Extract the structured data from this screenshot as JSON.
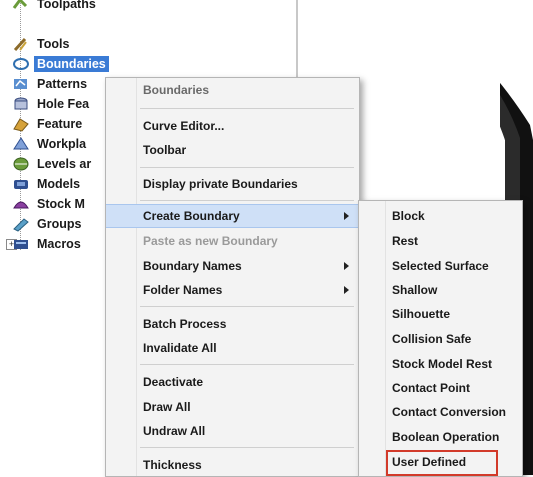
{
  "tree": {
    "items": [
      {
        "label": "Toolpaths",
        "icon": "toolpaths-icon"
      },
      {
        "label": "Tools",
        "icon": "tools-icon"
      },
      {
        "label": "Boundaries",
        "icon": "boundaries-icon",
        "selected": true
      },
      {
        "label": "Patterns",
        "icon": "patterns-icon"
      },
      {
        "label": "Hole Fea",
        "icon": "hole-features-icon"
      },
      {
        "label": "Feature",
        "icon": "feature-icon"
      },
      {
        "label": "Workpla",
        "icon": "workplanes-icon"
      },
      {
        "label": "Levels ar",
        "icon": "levels-icon"
      },
      {
        "label": "Models",
        "icon": "models-icon"
      },
      {
        "label": "Stock M",
        "icon": "stock-models-icon"
      },
      {
        "label": "Groups",
        "icon": "groups-icon"
      },
      {
        "label": "Macros",
        "icon": "macros-icon"
      }
    ],
    "selection_color": "#3a7bd5"
  },
  "menu": {
    "header": "Boundaries",
    "items": [
      {
        "label": "Curve Editor..."
      },
      {
        "label": "Toolbar"
      },
      {
        "label": "Display private Boundaries"
      },
      {
        "label": "Create Boundary",
        "submenu": true,
        "active": true
      },
      {
        "label": "Paste as new Boundary",
        "disabled": true
      },
      {
        "label": "Boundary Names",
        "submenu": true
      },
      {
        "label": "Folder Names",
        "submenu": true
      },
      {
        "label": "Batch Process"
      },
      {
        "label": "Invalidate All"
      },
      {
        "label": "Deactivate"
      },
      {
        "label": "Draw All"
      },
      {
        "label": "Undraw All"
      },
      {
        "label": "Thickness"
      }
    ],
    "active_color": "#cfe0f7"
  },
  "submenu": {
    "items": [
      {
        "label": "Block"
      },
      {
        "label": "Rest"
      },
      {
        "label": "Selected Surface"
      },
      {
        "label": "Shallow"
      },
      {
        "label": "Silhouette"
      },
      {
        "label": "Collision Safe"
      },
      {
        "label": "Stock Model Rest"
      },
      {
        "label": "Contact Point"
      },
      {
        "label": "Contact Conversion"
      },
      {
        "label": "Boolean Operation"
      },
      {
        "label": "User Defined",
        "highlighted": true
      }
    ],
    "highlight_color": "#d23a2a"
  }
}
